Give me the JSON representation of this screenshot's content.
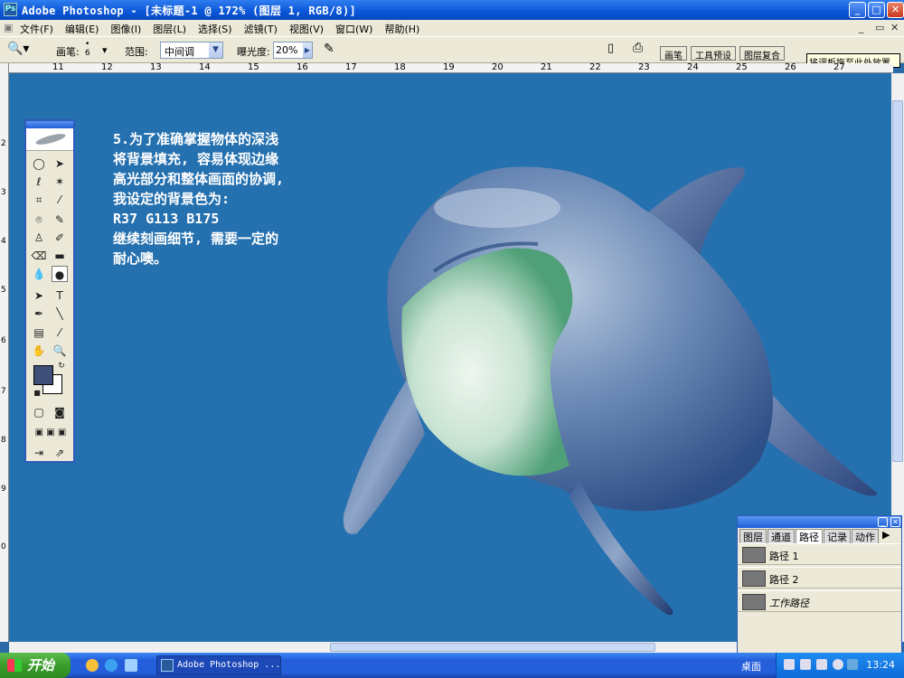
{
  "window": {
    "title": "Adobe Photoshop - [未标题-1 @ 172% (图层 1, RGB/8)]",
    "min": "_",
    "max": "□",
    "close": "✕"
  },
  "menu": [
    "文件(F)",
    "编辑(E)",
    "图像(I)",
    "图层(L)",
    "选择(S)",
    "滤镜(T)",
    "视图(V)",
    "窗口(W)",
    "帮助(H)"
  ],
  "options": {
    "brush_label": "画笔:",
    "brush_size": "6",
    "range_label": "范围:",
    "range_value": "中间调",
    "exposure_label": "曝光度:",
    "exposure_value": "20%"
  },
  "palette_well": {
    "tabs": [
      "画笔",
      "工具预设",
      "图层复合"
    ],
    "hint": "将调板拖至此处放置"
  },
  "rulers": {
    "h": [
      "11",
      "12",
      "13",
      "14",
      "15",
      "16",
      "17",
      "18",
      "19",
      "20",
      "21",
      "22",
      "23",
      "24",
      "25",
      "26",
      "27"
    ],
    "v": [
      "2",
      "3",
      "4",
      "5",
      "6",
      "7",
      "8",
      "9",
      "0"
    ]
  },
  "instructions": "5.为了准确掌握物体的深浅\n将背景填充, 容易体现边缘\n高光部分和整体画面的协调,\n我设定的背景色为:\nR37 G113 B175\n继续刻画细节, 需要一定的\n耐心噢。",
  "colors": {
    "background": "#2571af",
    "foreground_swatch": "#3e5078",
    "background_swatch": "#ffffff"
  },
  "paths_palette": {
    "tabs": [
      "图层",
      "通道",
      "路径",
      "记录",
      "动作"
    ],
    "rows": [
      "路径 1",
      "路径 2",
      "工作路径"
    ]
  },
  "taskbar": {
    "start": "开始",
    "task": "Adobe Photoshop ...",
    "desktop": "桌面",
    "clock": "13:24"
  }
}
